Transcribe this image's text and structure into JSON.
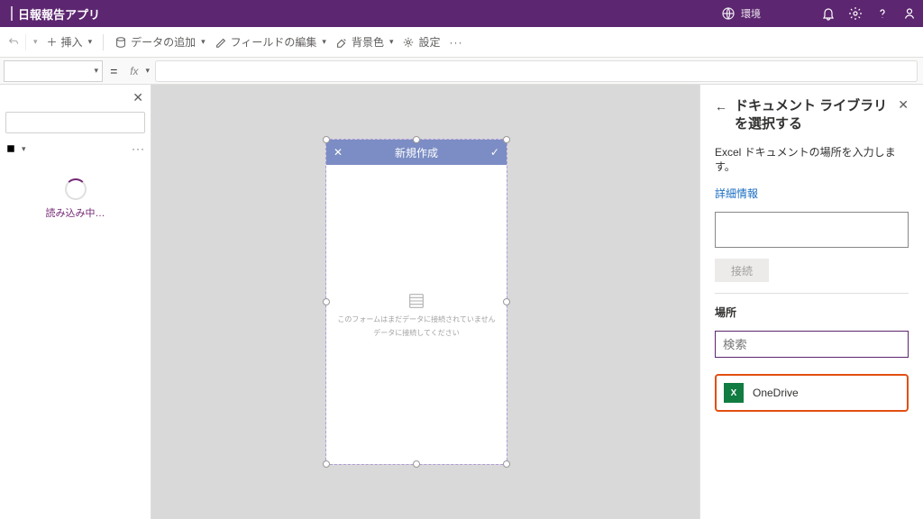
{
  "header": {
    "app_title": "日報報告アプリ",
    "environment_label": "環境"
  },
  "ribbon": {
    "insert": "挿入",
    "add_data": "データの追加",
    "edit_fields": "フィールドの編集",
    "background": "背景色",
    "settings": "設定"
  },
  "formula": {
    "fx": "fx"
  },
  "left_panel": {
    "tree_label": "口",
    "loading": "読み込み中…"
  },
  "canvas": {
    "form_title": "新規作成",
    "empty_line1": "このフォームはまだデータに接続されていません",
    "empty_line2": "データに接続してください"
  },
  "right_panel": {
    "title": "ドキュメント ライブラリ を選択する",
    "hint": "Excel ドキュメントの場所を入力します。",
    "more_info": "詳細情報",
    "connect": "接続",
    "location_label": "場所",
    "search_placeholder": "検索",
    "locations": [
      {
        "name": "OneDrive"
      }
    ]
  }
}
